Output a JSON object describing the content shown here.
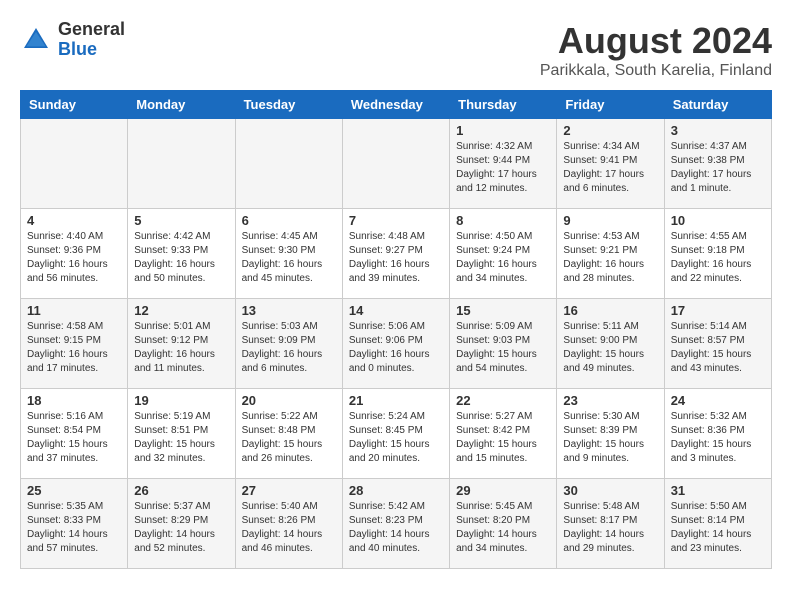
{
  "header": {
    "logo_line1": "General",
    "logo_line2": "Blue",
    "main_title": "August 2024",
    "subtitle": "Parikkala, South Karelia, Finland"
  },
  "weekdays": [
    "Sunday",
    "Monday",
    "Tuesday",
    "Wednesday",
    "Thursday",
    "Friday",
    "Saturday"
  ],
  "weeks": [
    [
      {
        "day": "",
        "info": ""
      },
      {
        "day": "",
        "info": ""
      },
      {
        "day": "",
        "info": ""
      },
      {
        "day": "",
        "info": ""
      },
      {
        "day": "1",
        "info": "Sunrise: 4:32 AM\nSunset: 9:44 PM\nDaylight: 17 hours\nand 12 minutes."
      },
      {
        "day": "2",
        "info": "Sunrise: 4:34 AM\nSunset: 9:41 PM\nDaylight: 17 hours\nand 6 minutes."
      },
      {
        "day": "3",
        "info": "Sunrise: 4:37 AM\nSunset: 9:38 PM\nDaylight: 17 hours\nand 1 minute."
      }
    ],
    [
      {
        "day": "4",
        "info": "Sunrise: 4:40 AM\nSunset: 9:36 PM\nDaylight: 16 hours\nand 56 minutes."
      },
      {
        "day": "5",
        "info": "Sunrise: 4:42 AM\nSunset: 9:33 PM\nDaylight: 16 hours\nand 50 minutes."
      },
      {
        "day": "6",
        "info": "Sunrise: 4:45 AM\nSunset: 9:30 PM\nDaylight: 16 hours\nand 45 minutes."
      },
      {
        "day": "7",
        "info": "Sunrise: 4:48 AM\nSunset: 9:27 PM\nDaylight: 16 hours\nand 39 minutes."
      },
      {
        "day": "8",
        "info": "Sunrise: 4:50 AM\nSunset: 9:24 PM\nDaylight: 16 hours\nand 34 minutes."
      },
      {
        "day": "9",
        "info": "Sunrise: 4:53 AM\nSunset: 9:21 PM\nDaylight: 16 hours\nand 28 minutes."
      },
      {
        "day": "10",
        "info": "Sunrise: 4:55 AM\nSunset: 9:18 PM\nDaylight: 16 hours\nand 22 minutes."
      }
    ],
    [
      {
        "day": "11",
        "info": "Sunrise: 4:58 AM\nSunset: 9:15 PM\nDaylight: 16 hours\nand 17 minutes."
      },
      {
        "day": "12",
        "info": "Sunrise: 5:01 AM\nSunset: 9:12 PM\nDaylight: 16 hours\nand 11 minutes."
      },
      {
        "day": "13",
        "info": "Sunrise: 5:03 AM\nSunset: 9:09 PM\nDaylight: 16 hours\nand 6 minutes."
      },
      {
        "day": "14",
        "info": "Sunrise: 5:06 AM\nSunset: 9:06 PM\nDaylight: 16 hours\nand 0 minutes."
      },
      {
        "day": "15",
        "info": "Sunrise: 5:09 AM\nSunset: 9:03 PM\nDaylight: 15 hours\nand 54 minutes."
      },
      {
        "day": "16",
        "info": "Sunrise: 5:11 AM\nSunset: 9:00 PM\nDaylight: 15 hours\nand 49 minutes."
      },
      {
        "day": "17",
        "info": "Sunrise: 5:14 AM\nSunset: 8:57 PM\nDaylight: 15 hours\nand 43 minutes."
      }
    ],
    [
      {
        "day": "18",
        "info": "Sunrise: 5:16 AM\nSunset: 8:54 PM\nDaylight: 15 hours\nand 37 minutes."
      },
      {
        "day": "19",
        "info": "Sunrise: 5:19 AM\nSunset: 8:51 PM\nDaylight: 15 hours\nand 32 minutes."
      },
      {
        "day": "20",
        "info": "Sunrise: 5:22 AM\nSunset: 8:48 PM\nDaylight: 15 hours\nand 26 minutes."
      },
      {
        "day": "21",
        "info": "Sunrise: 5:24 AM\nSunset: 8:45 PM\nDaylight: 15 hours\nand 20 minutes."
      },
      {
        "day": "22",
        "info": "Sunrise: 5:27 AM\nSunset: 8:42 PM\nDaylight: 15 hours\nand 15 minutes."
      },
      {
        "day": "23",
        "info": "Sunrise: 5:30 AM\nSunset: 8:39 PM\nDaylight: 15 hours\nand 9 minutes."
      },
      {
        "day": "24",
        "info": "Sunrise: 5:32 AM\nSunset: 8:36 PM\nDaylight: 15 hours\nand 3 minutes."
      }
    ],
    [
      {
        "day": "25",
        "info": "Sunrise: 5:35 AM\nSunset: 8:33 PM\nDaylight: 14 hours\nand 57 minutes."
      },
      {
        "day": "26",
        "info": "Sunrise: 5:37 AM\nSunset: 8:29 PM\nDaylight: 14 hours\nand 52 minutes."
      },
      {
        "day": "27",
        "info": "Sunrise: 5:40 AM\nSunset: 8:26 PM\nDaylight: 14 hours\nand 46 minutes."
      },
      {
        "day": "28",
        "info": "Sunrise: 5:42 AM\nSunset: 8:23 PM\nDaylight: 14 hours\nand 40 minutes."
      },
      {
        "day": "29",
        "info": "Sunrise: 5:45 AM\nSunset: 8:20 PM\nDaylight: 14 hours\nand 34 minutes."
      },
      {
        "day": "30",
        "info": "Sunrise: 5:48 AM\nSunset: 8:17 PM\nDaylight: 14 hours\nand 29 minutes."
      },
      {
        "day": "31",
        "info": "Sunrise: 5:50 AM\nSunset: 8:14 PM\nDaylight: 14 hours\nand 23 minutes."
      }
    ]
  ]
}
